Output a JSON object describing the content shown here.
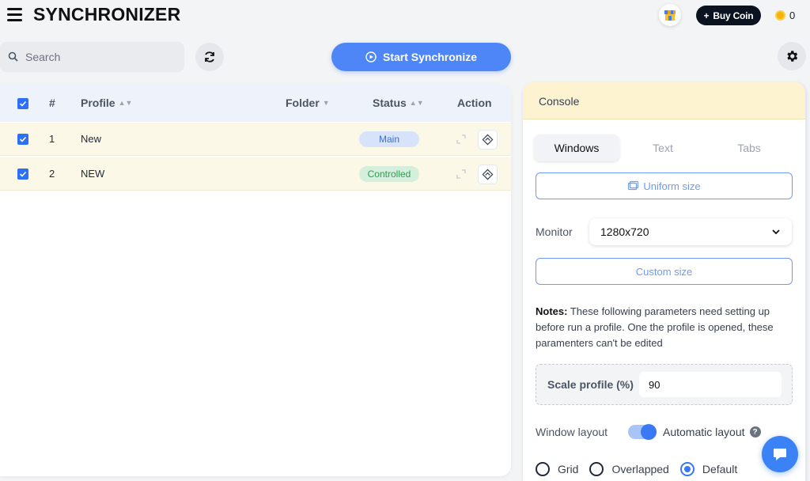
{
  "app": {
    "title": "SYNCHRONIZER"
  },
  "header": {
    "buy_coin_label": "Buy Coin",
    "coin_balance": "0"
  },
  "toolbar": {
    "search_placeholder": "Search",
    "start_label": "Start Synchronize"
  },
  "table": {
    "columns": {
      "index": "#",
      "profile": "Profile",
      "folder": "Folder",
      "status": "Status",
      "action": "Action"
    },
    "rows": [
      {
        "index": "1",
        "profile": "New",
        "folder": "",
        "status": "Main"
      },
      {
        "index": "2",
        "profile": "NEW",
        "folder": "",
        "status": "Controlled"
      }
    ]
  },
  "console": {
    "title": "Console",
    "tabs": [
      {
        "label": "Windows",
        "active": true
      },
      {
        "label": "Text",
        "active": false
      },
      {
        "label": "Tabs",
        "active": false
      }
    ],
    "uniform_size_label": "Uniform size",
    "monitor_label": "Monitor",
    "monitor_value": "1280x720",
    "custom_size_label": "Custom size",
    "notes_title": "Notes:",
    "notes_text": " These following parameters need setting up before run a profile. One the profile is opened, these paramenters can't be edited",
    "scale_label": "Scale profile (%)",
    "scale_value": "90",
    "window_layout_label": "Window layout",
    "automatic_layout_label": "Automatic layout",
    "layout_options": [
      {
        "label": "Grid",
        "checked": false
      },
      {
        "label": "Overlapped",
        "checked": false
      },
      {
        "label": "Default",
        "checked": true
      }
    ]
  },
  "colors": {
    "accent": "#4f86f7",
    "row_highlight": "#fcf8e8",
    "console_header": "#fdf3d1"
  }
}
